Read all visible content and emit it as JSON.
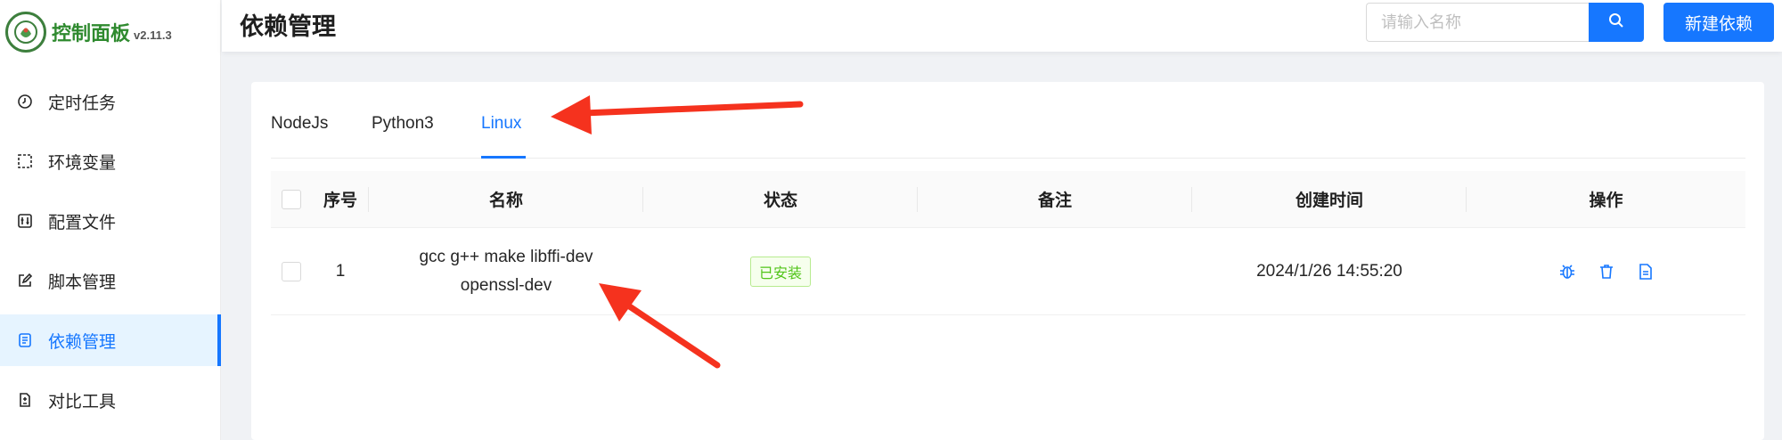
{
  "brand": {
    "title": "控制面板",
    "version": "v2.11.3"
  },
  "sidebar": {
    "items": [
      {
        "label": "定时任务",
        "icon": "clock-icon",
        "active": false
      },
      {
        "label": "环境变量",
        "icon": "dashed-square-icon",
        "active": false
      },
      {
        "label": "配置文件",
        "icon": "sliders-icon",
        "active": false
      },
      {
        "label": "脚本管理",
        "icon": "edit-icon",
        "active": false
      },
      {
        "label": "依赖管理",
        "icon": "package-icon",
        "active": true
      },
      {
        "label": "对比工具",
        "icon": "diff-icon",
        "active": false
      }
    ]
  },
  "header": {
    "title": "依赖管理",
    "search_placeholder": "请输入名称",
    "new_button": "新建依赖"
  },
  "tabs": [
    {
      "label": "NodeJs",
      "active": false
    },
    {
      "label": "Python3",
      "active": false
    },
    {
      "label": "Linux",
      "active": true
    }
  ],
  "table": {
    "columns": [
      "序号",
      "名称",
      "状态",
      "备注",
      "创建时间",
      "操作"
    ],
    "rows": [
      {
        "index": "1",
        "name_line1": "gcc g++ make libffi-dev",
        "name_line2": "openssl-dev",
        "status": "已安装",
        "remark": "",
        "created": "2024/1/26 14:55:20"
      }
    ]
  },
  "colors": {
    "primary": "#1677ff",
    "brand_green": "#2f8a2f",
    "tag_green": "#52c41a",
    "annotation_red": "#f5321e"
  }
}
